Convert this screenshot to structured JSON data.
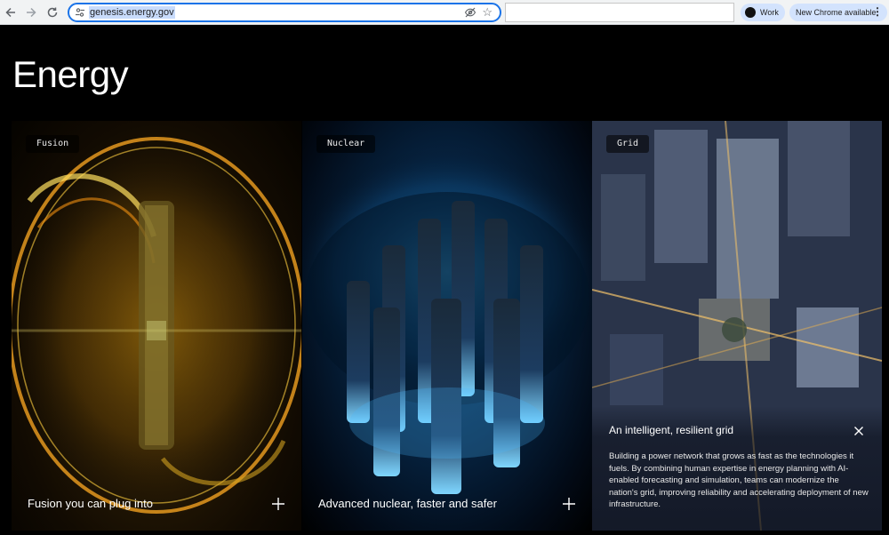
{
  "browser": {
    "url": "genesis.energy.gov",
    "profile_label": "Work",
    "update_label": "New Chrome available"
  },
  "page": {
    "title": "Energy"
  },
  "cards": [
    {
      "tag": "Fusion",
      "caption": "Fusion you can plug into"
    },
    {
      "tag": "Nuclear",
      "caption": "Advanced nuclear, faster and safer"
    },
    {
      "tag": "Grid",
      "heading": "An intelligent, resilient grid",
      "body": "Building a power network that grows as fast as the technologies it fuels. By combining human expertise in energy planning with AI-enabled forecasting and simulation, teams can modernize the nation's grid, improving reliability and accelerating deployment of new infrastructure."
    }
  ],
  "colors": {
    "accent": "#1a73e8",
    "chip_bg": "#d3e3fd",
    "page_bg": "#000000"
  }
}
